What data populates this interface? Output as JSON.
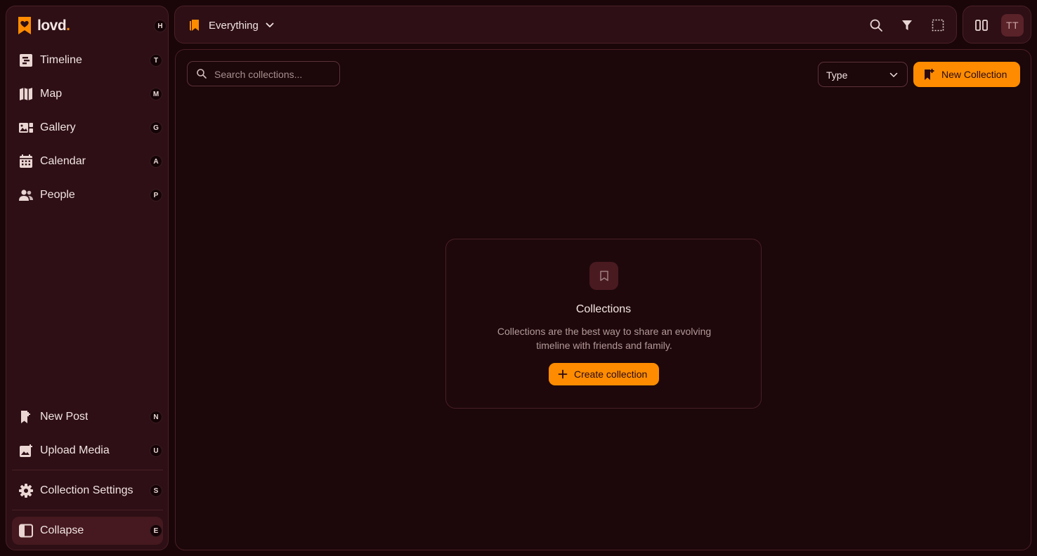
{
  "app": {
    "name": "lovd",
    "name_dot": ".",
    "shortcut": "H",
    "logo_icon": "heart-bookmark-logo-icon"
  },
  "colors": {
    "accent": "#ff8c00",
    "background": "#1a0609",
    "panel": "#2d0f15",
    "border": "#4a2026",
    "text": "#f2e4e2",
    "muted_text": "#b49a99"
  },
  "sidebar": {
    "nav": [
      {
        "label": "Timeline",
        "key": "T",
        "icon": "timeline-icon"
      },
      {
        "label": "Map",
        "key": "M",
        "icon": "map-icon"
      },
      {
        "label": "Gallery",
        "key": "G",
        "icon": "gallery-icon"
      },
      {
        "label": "Calendar",
        "key": "A",
        "icon": "calendar-icon"
      },
      {
        "label": "People",
        "key": "P",
        "icon": "people-icon"
      }
    ],
    "actions": [
      {
        "label": "New Post",
        "key": "N",
        "icon": "new-post-icon"
      },
      {
        "label": "Upload Media",
        "key": "U",
        "icon": "upload-media-icon"
      }
    ],
    "settings": {
      "label": "Collection Settings",
      "key": "S",
      "icon": "gear-icon"
    },
    "collapse": {
      "label": "Collapse",
      "key": "E",
      "icon": "sidebar-collapse-icon"
    }
  },
  "topbar": {
    "scope_label": "Everything",
    "scope_icon": "bookmarks-icon",
    "icons": [
      "search-icon",
      "filter-icon",
      "select-icon"
    ],
    "layout_icon": "columns-icon",
    "avatar_initials": "TT"
  },
  "main": {
    "search_placeholder": "Search collections...",
    "search_value": "",
    "type_select": {
      "selected": "Type"
    },
    "new_collection_label": "New Collection",
    "empty": {
      "icon": "bookmark-icon",
      "title": "Collections",
      "description": "Collections are the best way to share an evolving timeline with friends and family.",
      "button_label": "Create collection"
    }
  }
}
